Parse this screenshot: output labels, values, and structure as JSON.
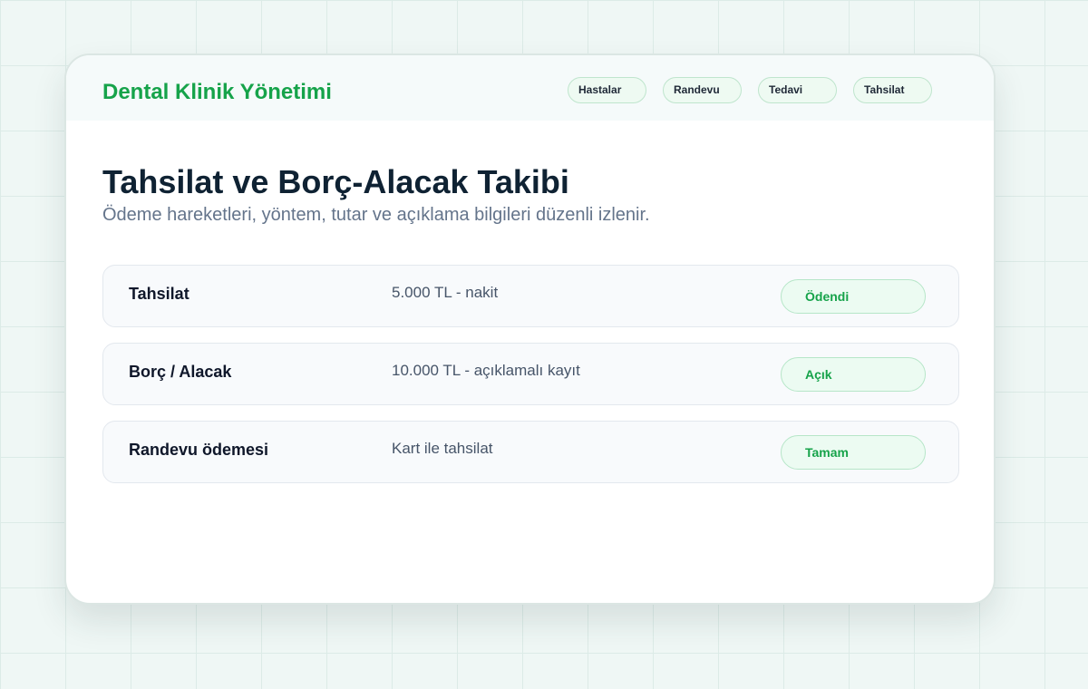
{
  "header": {
    "brand": "Dental Klinik Yönetimi",
    "nav": [
      "Hastalar",
      "Randevu",
      "Tedavi",
      "Tahsilat"
    ]
  },
  "main": {
    "title": "Tahsilat ve Borç-Alacak Takibi",
    "subtitle": "Ödeme hareketleri, yöntem, tutar ve açıklama bilgileri düzenli izlenir.",
    "rows": [
      {
        "title": "Tahsilat",
        "detail": "5.000 TL - nakit",
        "status": "Ödendi"
      },
      {
        "title": "Borç / Alacak",
        "detail": "10.000 TL - açıklamalı kayıt",
        "status": "Açık"
      },
      {
        "title": "Randevu ödemesi",
        "detail": "Kart ile tahsilat",
        "status": "Tamam"
      }
    ]
  },
  "colors": {
    "brand": "#16a34a",
    "title": "#0f2233",
    "subtitle": "#64748b",
    "status_bg": "#ecfbf2"
  }
}
